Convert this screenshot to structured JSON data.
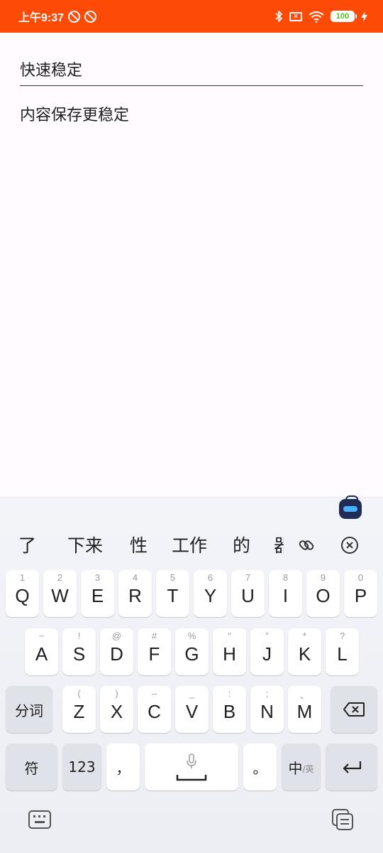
{
  "status_bar": {
    "time": "上午9:37",
    "icons": [
      "block-icon",
      "block-icon",
      "bluetooth-icon",
      "sim-off-icon",
      "wifi-icon",
      "battery-icon",
      "charging-icon"
    ],
    "battery": "100",
    "background": "#fe4a07"
  },
  "note": {
    "title": "快速稳定",
    "body": "内容保存更稳定"
  },
  "keyboard": {
    "candidates": [
      "了",
      "下来",
      "性",
      "工作",
      "的",
      "器"
    ],
    "row1": [
      {
        "key": "Q",
        "sub": "1"
      },
      {
        "key": "W",
        "sub": "2"
      },
      {
        "key": "E",
        "sub": "3"
      },
      {
        "key": "R",
        "sub": "4"
      },
      {
        "key": "T",
        "sub": "5"
      },
      {
        "key": "Y",
        "sub": "6"
      },
      {
        "key": "U",
        "sub": "7"
      },
      {
        "key": "I",
        "sub": "8"
      },
      {
        "key": "O",
        "sub": "9"
      },
      {
        "key": "P",
        "sub": "0"
      }
    ],
    "row2": [
      {
        "key": "A",
        "sub": "~"
      },
      {
        "key": "S",
        "sub": "!"
      },
      {
        "key": "D",
        "sub": "@"
      },
      {
        "key": "F",
        "sub": "#"
      },
      {
        "key": "G",
        "sub": "%"
      },
      {
        "key": "H",
        "sub": "“"
      },
      {
        "key": "J",
        "sub": "”"
      },
      {
        "key": "K",
        "sub": "*"
      },
      {
        "key": "L",
        "sub": "?"
      }
    ],
    "row3": [
      {
        "key": "Z",
        "sub": "("
      },
      {
        "key": "X",
        "sub": ")"
      },
      {
        "key": "C",
        "sub": "–"
      },
      {
        "key": "V",
        "sub": "_"
      },
      {
        "key": "B",
        "sub": ":"
      },
      {
        "key": "N",
        "sub": ";"
      },
      {
        "key": "M",
        "sub": "、"
      }
    ],
    "segment_label": "分词",
    "symbol_label": "符",
    "number_label": "123",
    "comma_label": "，",
    "period_label": "。",
    "lang_main": "中",
    "lang_sub": "/英"
  }
}
